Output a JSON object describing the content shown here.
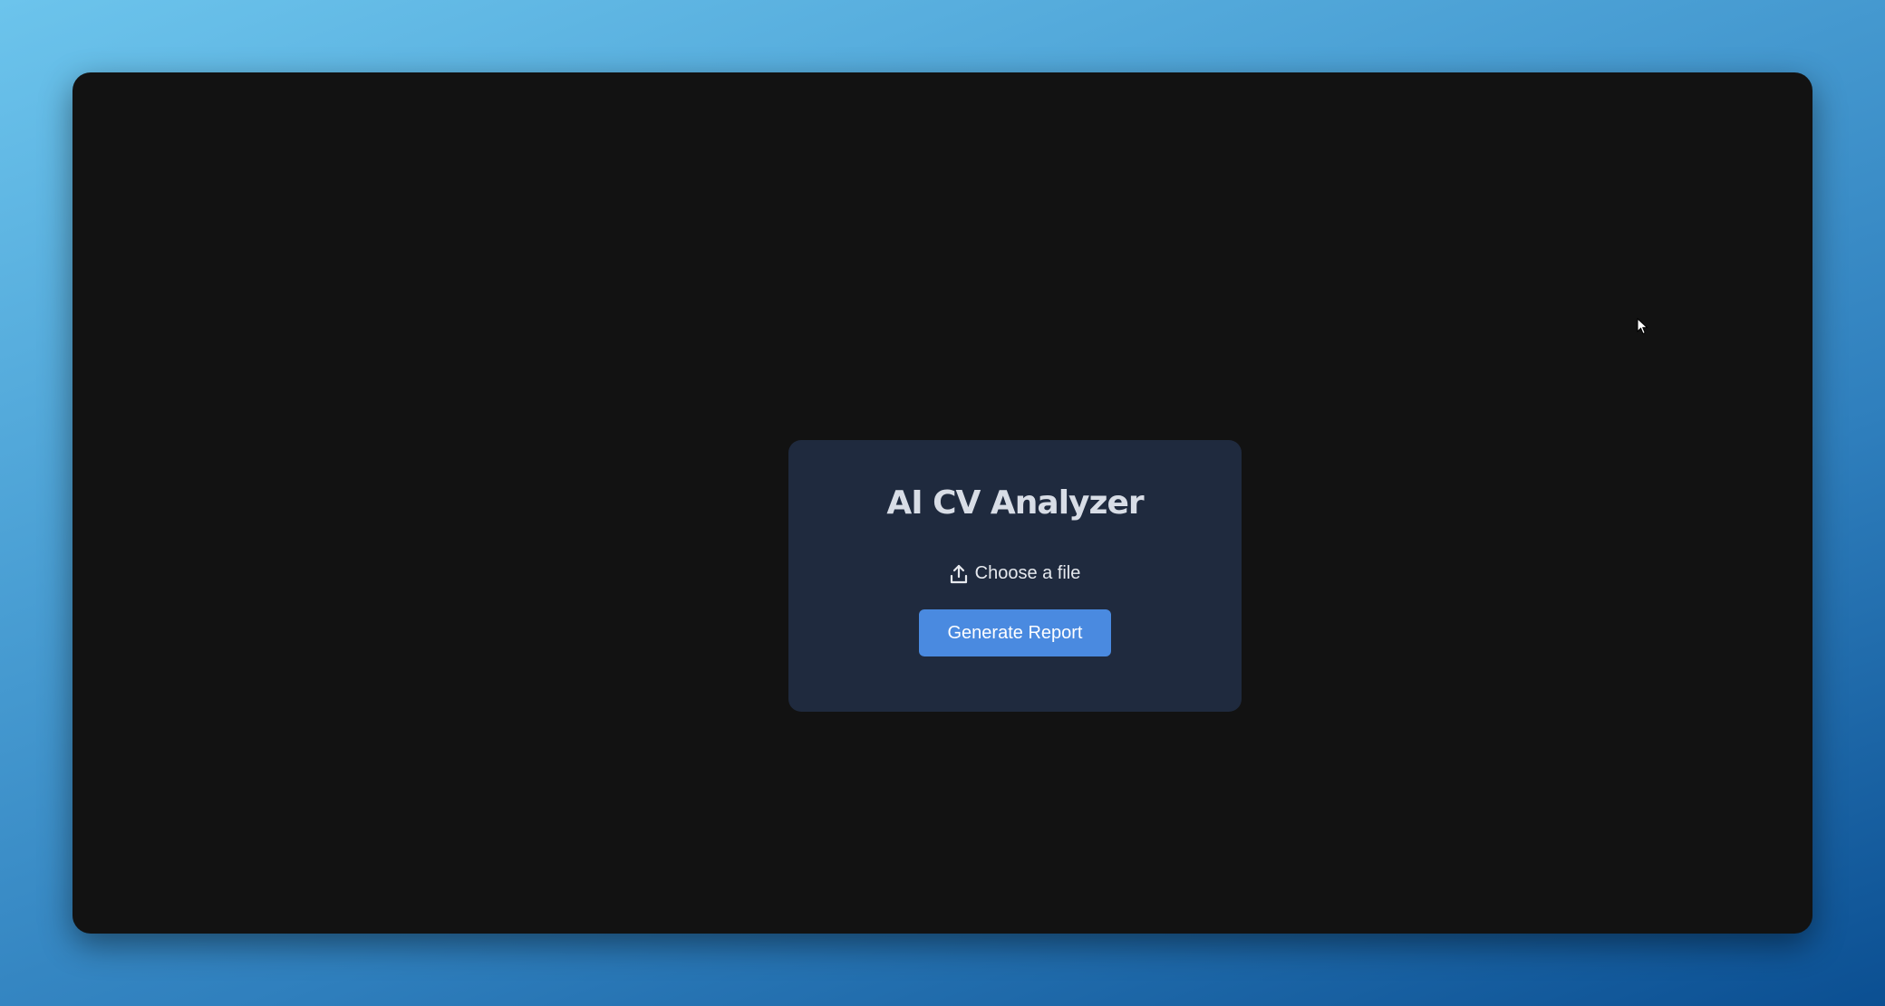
{
  "app": {
    "title": "AI CV Analyzer",
    "file_picker_label": "Choose a file",
    "file_picker_icon": "upload-icon",
    "generate_button_label": "Generate Report"
  },
  "colors": {
    "window_background": "#121212",
    "card_background": "#1f2a3e",
    "accent": "#4a8ae0",
    "title_text": "#d8dde6"
  }
}
